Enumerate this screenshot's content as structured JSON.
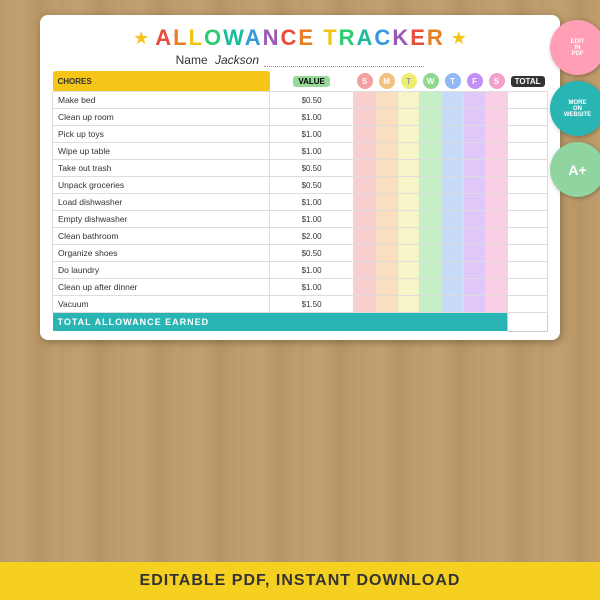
{
  "title": "ALLOWANCE TRACKER",
  "name_label": "Name",
  "name_value": "Jackson",
  "headers": {
    "chores": "CHORES",
    "value": "VALUE",
    "days": [
      "S",
      "M",
      "T",
      "W",
      "T",
      "F",
      "S"
    ],
    "total": "TOTAL"
  },
  "chores": [
    {
      "task": "Make bed",
      "value": "$0.50"
    },
    {
      "task": "Clean up room",
      "value": "$1.00"
    },
    {
      "task": "Pick up toys",
      "value": "$1.00"
    },
    {
      "task": "Wipe up table",
      "value": "$1.00"
    },
    {
      "task": "Take out trash",
      "value": "$0.50"
    },
    {
      "task": "Unpack groceries",
      "value": "$0.50"
    },
    {
      "task": "Load dishwasher",
      "value": "$1.00"
    },
    {
      "task": "Empty dishwasher",
      "value": "$1.00"
    },
    {
      "task": "Clean bathroom",
      "value": "$2.00"
    },
    {
      "task": "Organize shoes",
      "value": "$0.50"
    },
    {
      "task": "Do laundry",
      "value": "$1.00"
    },
    {
      "task": "Clean up after dinner",
      "value": "$1.00"
    },
    {
      "task": "Vacuum",
      "value": "$1.50"
    }
  ],
  "footer": {
    "label": "TOTAL ALLOWANCE EARNED",
    "value": ""
  },
  "bottom_bar": "EDITABLE PDF, INSTANT DOWNLOAD",
  "badges": [
    {
      "line1": "EDIT",
      "line2": "IN",
      "line3": "PDF"
    },
    {
      "line1": "MORE",
      "line2": "ON",
      "line3": "WEBSITE"
    },
    {
      "line1": "A+"
    }
  ],
  "day_colors": [
    "#f4a0a0",
    "#f4c080",
    "#eded90",
    "#90e090",
    "#90b8f4",
    "#c090f4",
    "#f4a0cc"
  ]
}
